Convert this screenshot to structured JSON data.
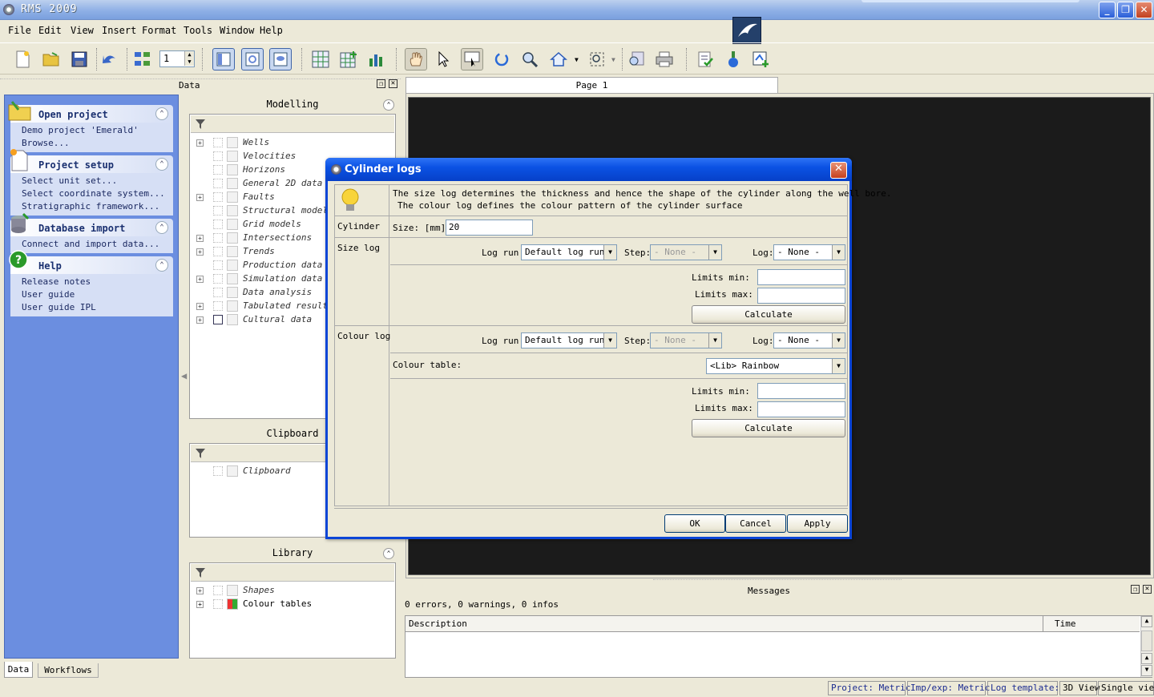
{
  "app": {
    "title": "RMS 2009"
  },
  "menu": [
    "File",
    "Edit",
    "View",
    "Insert",
    "Format",
    "Tools",
    "Window",
    "Help"
  ],
  "toolbar": {
    "page_number": "1"
  },
  "data_dock": {
    "title": "Data"
  },
  "tasks": {
    "open_project": {
      "title": "Open project",
      "items": [
        "Demo project 'Emerald'",
        "Browse..."
      ]
    },
    "project_setup": {
      "title": "Project setup",
      "items": [
        "Select unit set...",
        "Select coordinate system...",
        "Stratigraphic framework..."
      ]
    },
    "database_import": {
      "title": "Database import",
      "items": [
        "Connect and import data..."
      ]
    },
    "help": {
      "title": "Help",
      "items": [
        "Release notes",
        "User guide",
        "User guide IPL"
      ]
    }
  },
  "modelling": {
    "title": "Modelling",
    "items": [
      "Wells",
      "Velocities",
      "Horizons",
      "General 2D data",
      "Faults",
      "Structural models",
      "Grid models",
      "Intersections",
      "Trends",
      "Production data",
      "Simulation data",
      "Data analysis",
      "Tabulated results",
      "Cultural data"
    ]
  },
  "clipboard": {
    "title": "Clipboard",
    "items": [
      "Clipboard"
    ]
  },
  "library": {
    "title": "Library",
    "items": [
      "Shapes",
      "Colour tables"
    ]
  },
  "left_tabs": [
    "Data",
    "Workflows"
  ],
  "page_tab": "Page 1",
  "dialog": {
    "title": "Cylinder logs",
    "info_line1": "The size log determines the thickness and hence the shape of the cylinder along the well bore.",
    "info_line2": "The colour log defines the colour pattern of the cylinder surface",
    "cylinder_label": "Cylinder",
    "size_label": "Size: [mm]",
    "size_value": "20",
    "size_log": {
      "section": "Size log",
      "log_run_label": "Log run:",
      "log_run": "Default log run",
      "step_label": "Step:",
      "step": "- None -",
      "log_label": "Log:",
      "log": "- None -",
      "limits_min": "Limits min:",
      "limits_max": "Limits max:",
      "calculate": "Calculate"
    },
    "colour_log": {
      "section": "Colour log",
      "log_run_label": "Log run:",
      "log_run": "Default log run",
      "step_label": "Step:",
      "step": "- None -",
      "log_label": "Log:",
      "log": "- None -",
      "colour_table_label": "Colour table:",
      "colour_table": "<Lib> Rainbow",
      "limits_min": "Limits min:",
      "limits_max": "Limits max:",
      "calculate": "Calculate"
    },
    "ok": "OK",
    "cancel": "Cancel",
    "apply": "Apply"
  },
  "messages": {
    "title": "Messages",
    "summary": "0 errors, 0 warnings, 0 infos",
    "col_description": "Description",
    "col_time": "Time"
  },
  "status": [
    "Project: Metric",
    "Imp/exp: Metric",
    "Log template:",
    "3D View",
    "Single view"
  ]
}
